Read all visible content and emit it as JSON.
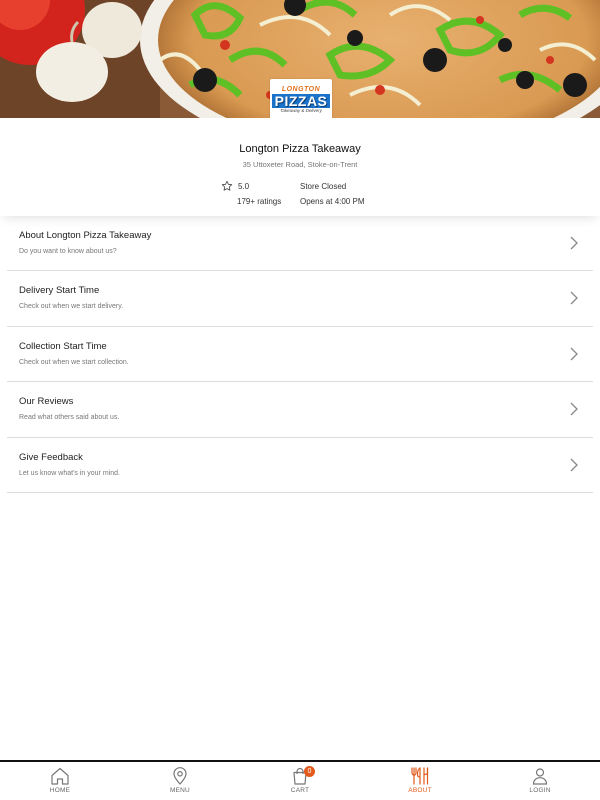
{
  "logo": {
    "line1": "LONGTON",
    "line2": "PIZZAS",
    "line3": "Takeaway & Delivery"
  },
  "store": {
    "name": "Longton Pizza Takeaway",
    "address": "35 Uttoxeter Road, Stoke-on-Trent",
    "rating": "5.0",
    "ratings_count": "179+ ratings",
    "status": "Store Closed",
    "opens": "Opens at 4:00 PM"
  },
  "menu_items": [
    {
      "title": "About Longton Pizza Takeaway",
      "subtitle": "Do you want to know about us?"
    },
    {
      "title": "Delivery Start Time",
      "subtitle": "Check out when we start delivery."
    },
    {
      "title": "Collection Start Time",
      "subtitle": "Check out when we start collection."
    },
    {
      "title": "Our Reviews",
      "subtitle": "Read what others said about us."
    },
    {
      "title": "Give Feedback",
      "subtitle": "Let us know what's in your mind."
    }
  ],
  "nav": {
    "home": "HOME",
    "menu": "MENU",
    "cart": "CART",
    "cart_count": "0",
    "about": "ABOUT",
    "login": "LOGIN"
  },
  "colors": {
    "accent": "#e25a1c",
    "divider": "#dcdcdc",
    "text_primary": "#222222",
    "text_secondary": "#777777"
  },
  "icons": [
    "star-icon",
    "chevron-right-icon",
    "home-icon",
    "location-pin-icon",
    "shopping-bag-icon",
    "cutlery-icon",
    "user-icon"
  ]
}
